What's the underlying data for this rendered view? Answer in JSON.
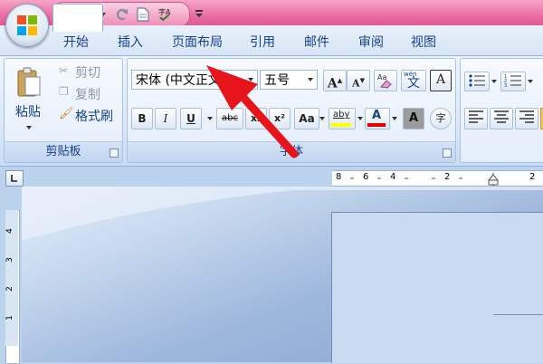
{
  "quick_access": {
    "icons": [
      "save-icon",
      "undo-icon",
      "redo-icon",
      "new-doc-icon",
      "spelling-icon",
      "customize-icon"
    ]
  },
  "tabs": [
    {
      "label": "开始",
      "active": true
    },
    {
      "label": "插入"
    },
    {
      "label": "页面布局"
    },
    {
      "label": "引用"
    },
    {
      "label": "邮件"
    },
    {
      "label": "审阅"
    },
    {
      "label": "视图"
    }
  ],
  "clipboard": {
    "paste_label": "粘贴",
    "cut_label": "剪切",
    "copy_label": "复制",
    "format_painter_label": "格式刷",
    "group_label": "剪贴板"
  },
  "font": {
    "font_name": "宋体 (中文正文)",
    "font_size": "五号",
    "group_label": "字体",
    "bold": "B",
    "italic": "I",
    "underline": "U",
    "strike": "abc",
    "subscript": "x₂",
    "superscript": "x²",
    "change_case": "Aa",
    "highlight": "aby",
    "font_color": "A",
    "char_shading": "A",
    "grow": "A",
    "shrink": "A",
    "phonetic": "wén",
    "phonetic_char": "文",
    "char_border": "A",
    "enclose": "字"
  },
  "ruler": {
    "top_ticks": [
      "8",
      "6",
      "4",
      "2",
      "2"
    ],
    "left_ticks": [
      "4",
      "3",
      "2",
      "1"
    ]
  },
  "colors": {
    "title_pink": "#e86aa0",
    "tab_text": "#15428b",
    "arrow_red": "#e8141b",
    "highlight_yellow": "#ffff00",
    "font_red": "#e00000"
  }
}
